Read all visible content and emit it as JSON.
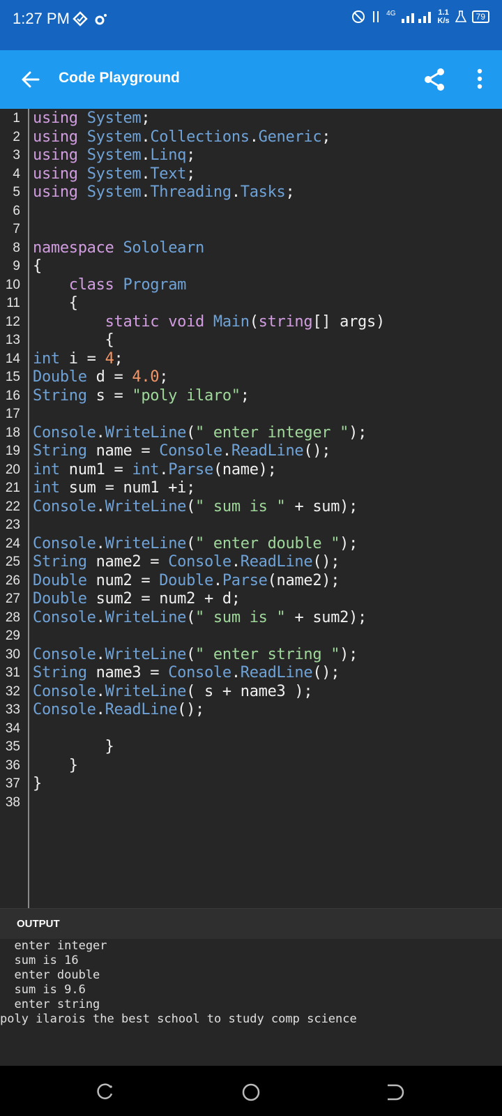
{
  "status_bar": {
    "time": "1:27 PM",
    "network": "4G",
    "speed_value": "1.1",
    "speed_unit": "K/s",
    "battery": "79"
  },
  "app_bar": {
    "title": "Code Playground",
    "back_icon": "arrow-left-icon",
    "share_icon": "share-icon",
    "menu_icon": "more-vert-icon"
  },
  "colors": {
    "keyword": "#d19de0",
    "type": "#6fa3d8",
    "string": "#9fd89a",
    "number": "#f29668",
    "plain": "#f0f0f0"
  },
  "code_lines": [
    {
      "n": "1",
      "tokens": [
        {
          "t": "using",
          "c": "k"
        },
        {
          "t": " "
        },
        {
          "t": "System",
          "c": "y"
        },
        {
          "t": ";"
        }
      ]
    },
    {
      "n": "2",
      "tokens": [
        {
          "t": "using",
          "c": "k"
        },
        {
          "t": " "
        },
        {
          "t": "System",
          "c": "y"
        },
        {
          "t": "."
        },
        {
          "t": "Collections",
          "c": "y"
        },
        {
          "t": "."
        },
        {
          "t": "Generic",
          "c": "y"
        },
        {
          "t": ";"
        }
      ]
    },
    {
      "n": "3",
      "tokens": [
        {
          "t": "using",
          "c": "k"
        },
        {
          "t": " "
        },
        {
          "t": "System",
          "c": "y"
        },
        {
          "t": "."
        },
        {
          "t": "Linq",
          "c": "y"
        },
        {
          "t": ";"
        }
      ]
    },
    {
      "n": "4",
      "tokens": [
        {
          "t": "using",
          "c": "k"
        },
        {
          "t": " "
        },
        {
          "t": "System",
          "c": "y"
        },
        {
          "t": "."
        },
        {
          "t": "Text",
          "c": "y"
        },
        {
          "t": ";"
        }
      ]
    },
    {
      "n": "5",
      "tokens": [
        {
          "t": "using",
          "c": "k"
        },
        {
          "t": " "
        },
        {
          "t": "System",
          "c": "y"
        },
        {
          "t": "."
        },
        {
          "t": "Threading",
          "c": "y"
        },
        {
          "t": "."
        },
        {
          "t": "Tasks",
          "c": "y"
        },
        {
          "t": ";"
        }
      ]
    },
    {
      "n": "6",
      "tokens": []
    },
    {
      "n": "7",
      "tokens": []
    },
    {
      "n": "8",
      "tokens": [
        {
          "t": "namespace",
          "c": "k"
        },
        {
          "t": " "
        },
        {
          "t": "Sololearn",
          "c": "y"
        }
      ]
    },
    {
      "n": "9",
      "tokens": [
        {
          "t": "{"
        }
      ]
    },
    {
      "n": "10",
      "tokens": [
        {
          "t": "    "
        },
        {
          "t": "class",
          "c": "k"
        },
        {
          "t": " "
        },
        {
          "t": "Program",
          "c": "y"
        }
      ]
    },
    {
      "n": "11",
      "tokens": [
        {
          "t": "    {"
        }
      ]
    },
    {
      "n": "12",
      "tokens": [
        {
          "t": "        "
        },
        {
          "t": "static",
          "c": "k"
        },
        {
          "t": " "
        },
        {
          "t": "void",
          "c": "k"
        },
        {
          "t": " "
        },
        {
          "t": "Main",
          "c": "y"
        },
        {
          "t": "("
        },
        {
          "t": "string",
          "c": "k"
        },
        {
          "t": "[] args)"
        }
      ]
    },
    {
      "n": "13",
      "tokens": [
        {
          "t": "        {"
        }
      ]
    },
    {
      "n": "14",
      "tokens": [
        {
          "t": "int",
          "c": "y"
        },
        {
          "t": " i = "
        },
        {
          "t": "4",
          "c": "n"
        },
        {
          "t": ";"
        }
      ]
    },
    {
      "n": "15",
      "tokens": [
        {
          "t": "Double",
          "c": "y"
        },
        {
          "t": " d = "
        },
        {
          "t": "4.0",
          "c": "n"
        },
        {
          "t": ";"
        }
      ]
    },
    {
      "n": "16",
      "tokens": [
        {
          "t": "String",
          "c": "y"
        },
        {
          "t": " s = "
        },
        {
          "t": "\"poly ilaro\"",
          "c": "s"
        },
        {
          "t": ";"
        }
      ]
    },
    {
      "n": "17",
      "tokens": []
    },
    {
      "n": "18",
      "tokens": [
        {
          "t": "Console",
          "c": "y"
        },
        {
          "t": "."
        },
        {
          "t": "WriteLine",
          "c": "y"
        },
        {
          "t": "("
        },
        {
          "t": "\" enter integer \"",
          "c": "s"
        },
        {
          "t": ");"
        }
      ]
    },
    {
      "n": "19",
      "tokens": [
        {
          "t": "String",
          "c": "y"
        },
        {
          "t": " name = "
        },
        {
          "t": "Console",
          "c": "y"
        },
        {
          "t": "."
        },
        {
          "t": "ReadLine",
          "c": "y"
        },
        {
          "t": "();"
        }
      ]
    },
    {
      "n": "20",
      "tokens": [
        {
          "t": "int",
          "c": "y"
        },
        {
          "t": " num1 = "
        },
        {
          "t": "int",
          "c": "y"
        },
        {
          "t": "."
        },
        {
          "t": "Parse",
          "c": "y"
        },
        {
          "t": "(name);"
        }
      ]
    },
    {
      "n": "21",
      "tokens": [
        {
          "t": "int",
          "c": "y"
        },
        {
          "t": " sum = num1 +i;"
        }
      ]
    },
    {
      "n": "22",
      "tokens": [
        {
          "t": "Console",
          "c": "y"
        },
        {
          "t": "."
        },
        {
          "t": "WriteLine",
          "c": "y"
        },
        {
          "t": "("
        },
        {
          "t": "\" sum is \"",
          "c": "s"
        },
        {
          "t": " + sum);"
        }
      ]
    },
    {
      "n": "23",
      "tokens": []
    },
    {
      "n": "24",
      "tokens": [
        {
          "t": "Console",
          "c": "y"
        },
        {
          "t": "."
        },
        {
          "t": "WriteLine",
          "c": "y"
        },
        {
          "t": "("
        },
        {
          "t": "\" enter double \"",
          "c": "s"
        },
        {
          "t": ");"
        }
      ]
    },
    {
      "n": "25",
      "tokens": [
        {
          "t": "String",
          "c": "y"
        },
        {
          "t": " name2 = "
        },
        {
          "t": "Console",
          "c": "y"
        },
        {
          "t": "."
        },
        {
          "t": "ReadLine",
          "c": "y"
        },
        {
          "t": "();"
        }
      ]
    },
    {
      "n": "26",
      "tokens": [
        {
          "t": "Double",
          "c": "y"
        },
        {
          "t": " num2 = "
        },
        {
          "t": "Double",
          "c": "y"
        },
        {
          "t": "."
        },
        {
          "t": "Parse",
          "c": "y"
        },
        {
          "t": "(name2);"
        }
      ]
    },
    {
      "n": "27",
      "tokens": [
        {
          "t": "Double",
          "c": "y"
        },
        {
          "t": " sum2 = num2 + d;"
        }
      ]
    },
    {
      "n": "28",
      "tokens": [
        {
          "t": "Console",
          "c": "y"
        },
        {
          "t": "."
        },
        {
          "t": "WriteLine",
          "c": "y"
        },
        {
          "t": "("
        },
        {
          "t": "\" sum is \"",
          "c": "s"
        },
        {
          "t": " + sum2);"
        }
      ]
    },
    {
      "n": "29",
      "tokens": []
    },
    {
      "n": "30",
      "tokens": [
        {
          "t": "Console",
          "c": "y"
        },
        {
          "t": "."
        },
        {
          "t": "WriteLine",
          "c": "y"
        },
        {
          "t": "("
        },
        {
          "t": "\" enter string \"",
          "c": "s"
        },
        {
          "t": ");"
        }
      ]
    },
    {
      "n": "31",
      "tokens": [
        {
          "t": "String",
          "c": "y"
        },
        {
          "t": " name3 = "
        },
        {
          "t": "Console",
          "c": "y"
        },
        {
          "t": "."
        },
        {
          "t": "ReadLine",
          "c": "y"
        },
        {
          "t": "();"
        }
      ]
    },
    {
      "n": "32",
      "tokens": [
        {
          "t": "Console",
          "c": "y"
        },
        {
          "t": "."
        },
        {
          "t": "WriteLine",
          "c": "y"
        },
        {
          "t": "( s + name3 );"
        }
      ]
    },
    {
      "n": "33",
      "tokens": [
        {
          "t": "Console",
          "c": "y"
        },
        {
          "t": "."
        },
        {
          "t": "ReadLine",
          "c": "y"
        },
        {
          "t": "();"
        }
      ]
    },
    {
      "n": "34",
      "tokens": []
    },
    {
      "n": "35",
      "tokens": [
        {
          "t": "        }"
        }
      ]
    },
    {
      "n": "36",
      "tokens": [
        {
          "t": "    }"
        }
      ]
    },
    {
      "n": "37",
      "tokens": [
        {
          "t": "}"
        }
      ]
    },
    {
      "n": "38",
      "tokens": []
    }
  ],
  "output": {
    "label": "OUTPUT",
    "lines": [
      "  enter integer",
      "  sum is 16",
      "  enter double",
      "  sum is 9.6",
      "  enter string",
      "poly ilarois the best school to study comp science"
    ]
  },
  "nav_bar": {
    "recents_icon": "recents-icon",
    "home_icon": "home-circle-icon",
    "back_icon": "nav-back-icon"
  }
}
